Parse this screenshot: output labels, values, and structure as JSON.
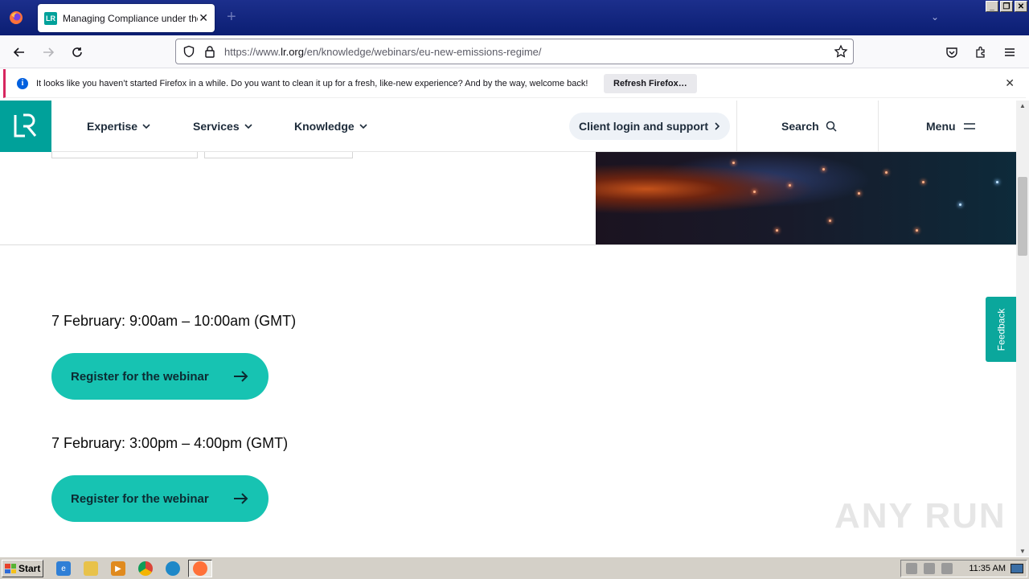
{
  "browser": {
    "tab_title": "Managing Compliance under the EU",
    "tab_favicon": "LR",
    "url_prefix": "https://www.",
    "url_domain": "lr.org",
    "url_path": "/en/knowledge/webinars/eu-new-emissions-regime/"
  },
  "notification": {
    "message": "It looks like you haven’t started Firefox in a while. Do you want to clean it up for a fresh, like-new experience? And by the way, welcome back!",
    "button": "Refresh Firefox…"
  },
  "site_header": {
    "nav": [
      "Expertise",
      "Services",
      "Knowledge"
    ],
    "client_login": "Client login and support",
    "search": "Search",
    "menu": "Menu"
  },
  "sessions": [
    {
      "time": "7 February: 9:00am – 10:00am (GMT)",
      "button": "Register for the webinar"
    },
    {
      "time": "7 February: 3:00pm – 4:00pm (GMT)",
      "button": "Register for the webinar"
    }
  ],
  "feedback": "Feedback",
  "watermark": "ANY RUN",
  "taskbar": {
    "start": "Start",
    "clock": "11:35 AM"
  },
  "colors": {
    "brand_teal": "#00a19a",
    "button_teal": "#17c3b2",
    "tabstrip": "#1c2f8c"
  }
}
